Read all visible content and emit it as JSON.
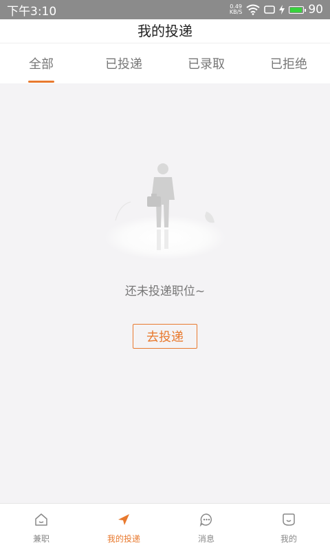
{
  "status_bar": {
    "time": "下午3:10",
    "net_speed_value": "0.49",
    "net_speed_unit": "KB/S",
    "battery": "90",
    "battery_level": 0.9
  },
  "header": {
    "title": "我的投递"
  },
  "tabs": [
    {
      "label": "全部",
      "active": true
    },
    {
      "label": "已投递",
      "active": false
    },
    {
      "label": "已录取",
      "active": false
    },
    {
      "label": "已拒绝",
      "active": false
    }
  ],
  "empty_state": {
    "message": "还未投递职位~",
    "button_label": "去投递"
  },
  "bottom_nav": [
    {
      "label": "兼职",
      "icon": "home-icon",
      "active": false
    },
    {
      "label": "我的投递",
      "icon": "send-icon",
      "active": true
    },
    {
      "label": "消息",
      "icon": "chat-icon",
      "active": false
    },
    {
      "label": "我的",
      "icon": "profile-icon",
      "active": false
    }
  ],
  "colors": {
    "accent": "#e8792e",
    "background": "#f4f3f5",
    "status_bar": "#8b8b8b"
  }
}
